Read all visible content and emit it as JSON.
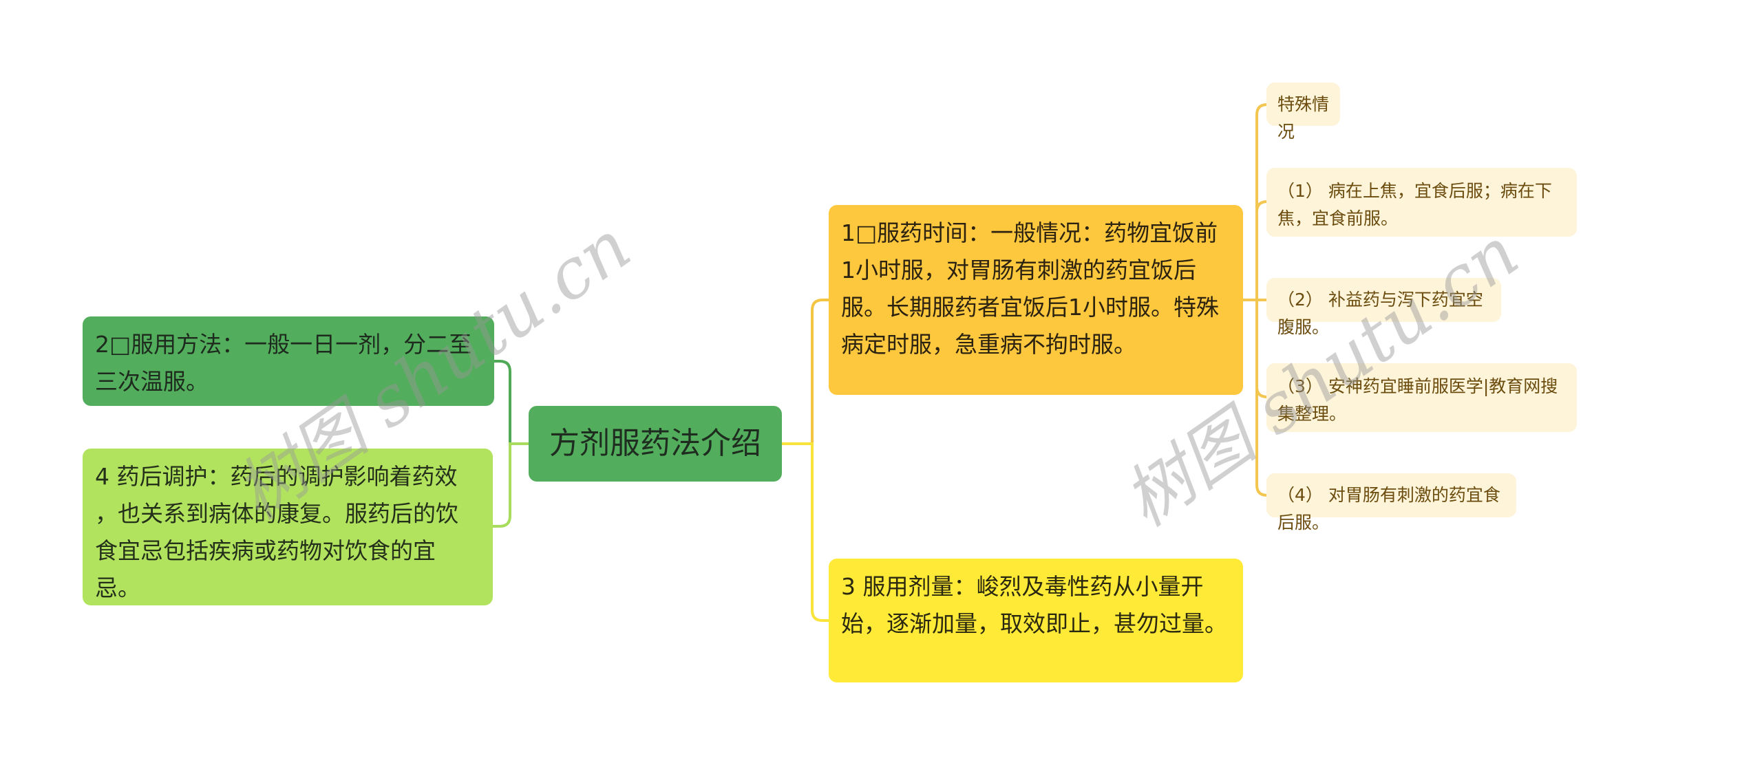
{
  "root": {
    "label": "方剂服药法介绍"
  },
  "left_branches": [
    {
      "label": "2□服用方法：一般一日一剂，分二至三次温服。",
      "color": "#52ad5c"
    },
    {
      "label": "4 药后调护：药后的调护影响着药效 ，也关系到病体的康复。服药后的饮食宜忌包括疾病或药物对饮食的宜忌。",
      "color": "#b2e35f"
    }
  ],
  "right_branches": [
    {
      "label": "1□服药时间：一般情况：药物宜饭前1小时服，对胃肠有刺激的药宜饭后服。长期服药者宜饭后1小时服。特殊病定时服，急重病不拘时服。",
      "color": "#fdc73e",
      "children": [
        {
          "label": "特殊情况"
        },
        {
          "label": "（1） 病在上焦，宜食后服；病在下焦，宜食前服。"
        },
        {
          "label": "（2） 补益药与泻下药宜空腹服。"
        },
        {
          "label": "（3） 安神药宜睡前服医学|教育网搜集整理。"
        },
        {
          "label": "（4） 对胃肠有刺激的药宜食后服。"
        }
      ]
    },
    {
      "label": "3 服用剂量：峻烈及毒性药从小量开始，逐渐加量，取效即止，甚勿过量。",
      "color": "#feea37"
    }
  ],
  "watermarks": [
    "树图 shutu.cn",
    "树图 shutu.cn"
  ],
  "colors": {
    "link_left_top": "#4fa957",
    "link_left_bottom": "#a8dc5c",
    "link_right_top": "#f4c443",
    "link_right_bottom": "#f9e43c",
    "link_leaves": "#f2c650"
  }
}
